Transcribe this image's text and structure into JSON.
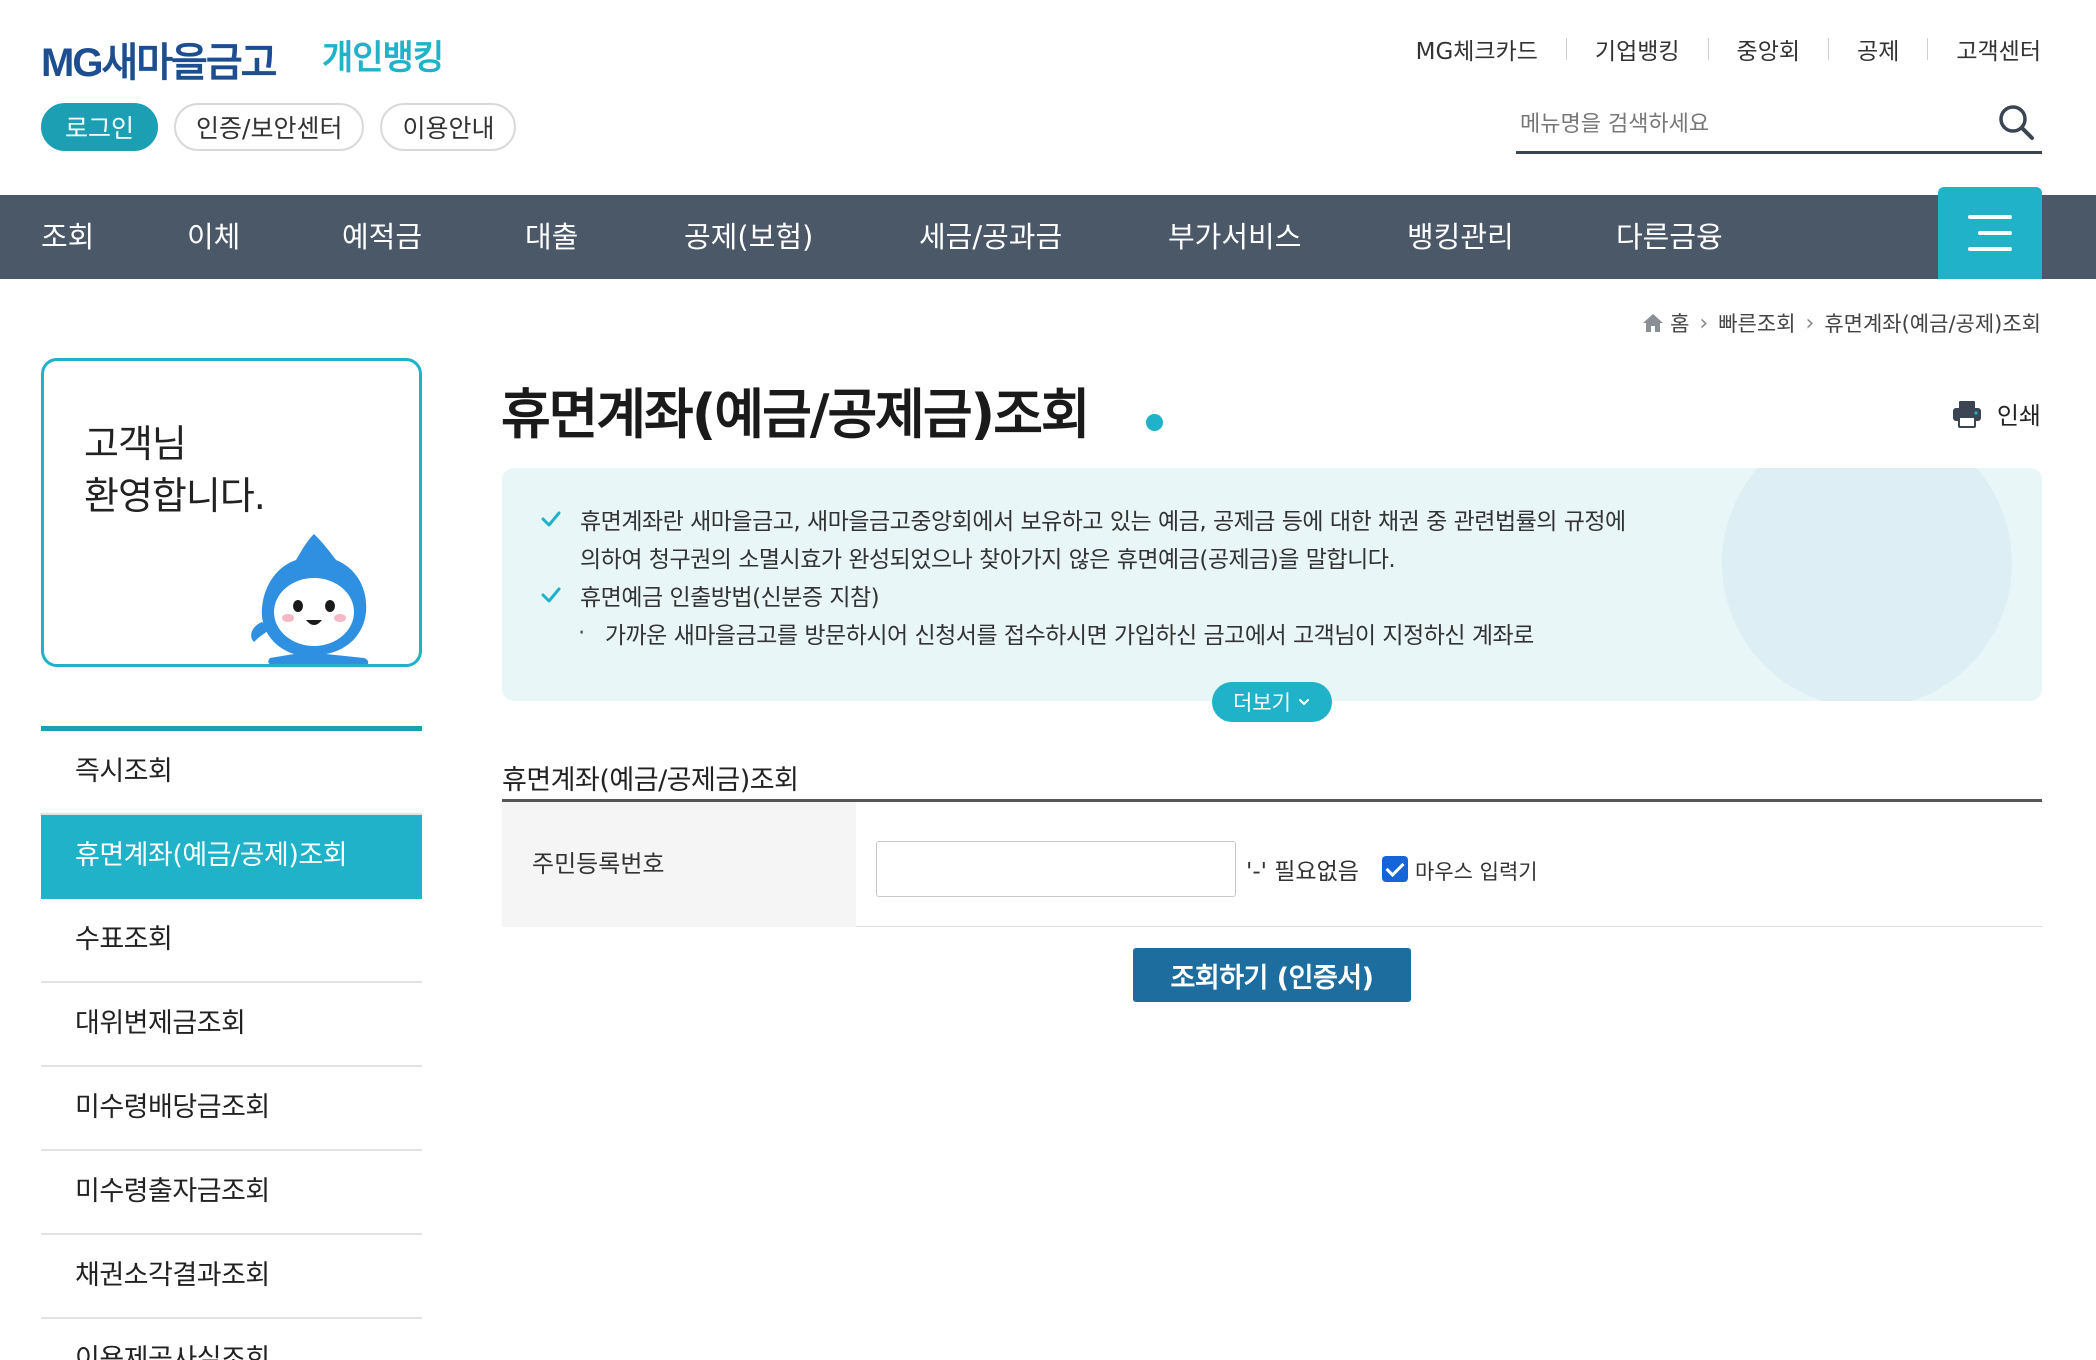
{
  "header": {
    "logo_text": "MG새마을금고",
    "service_name": "개인뱅킹",
    "util_nav": [
      "MG체크카드",
      "기업뱅킹",
      "중앙회",
      "공제",
      "고객센터"
    ],
    "quick_buttons": {
      "login": "로그인",
      "security": "인증/보안센터",
      "guide": "이용안내"
    },
    "search": {
      "placeholder": "메뉴명을 검색하세요",
      "value": ""
    }
  },
  "gnb": {
    "items": [
      "조회",
      "이체",
      "예적금",
      "대출",
      "공제(보험)",
      "세금/공과금",
      "부가서비스",
      "뱅킹관리",
      "다른금융"
    ]
  },
  "breadcrumb": [
    "홈",
    "빠른조회",
    "휴면계좌(예금/공제)조회"
  ],
  "sidebar": {
    "welcome_line1": "고객님",
    "welcome_line2": "환영합니다.",
    "items": [
      {
        "label": "즉시조회",
        "active": false
      },
      {
        "label": "휴면계좌(예금/공제)조회",
        "active": true
      },
      {
        "label": "수표조회",
        "active": false
      },
      {
        "label": "대위변제금조회",
        "active": false
      },
      {
        "label": "미수령배당금조회",
        "active": false
      },
      {
        "label": "미수령출자금조회",
        "active": false
      },
      {
        "label": "채권소각결과조회",
        "active": false
      },
      {
        "label": "이용제공사실조회",
        "active": false
      }
    ]
  },
  "main": {
    "title": "휴면계좌(예금/공제금)조회",
    "print_label": "인쇄",
    "info": {
      "line1": "휴면계좌란 새마을금고, 새마을금고중앙회에서 보유하고 있는 예금, 공제금 등에 대한 채권 중 관련법률의 규정에",
      "line1_cont": "의하여 청구권의 소멸시효가 완성되었으나 찾아가지 않은 휴면예금(공제금)을 말합니다.",
      "line2": "휴면예금 인출방법(신분증 지참)",
      "line2_sub": "가까운 새마을금고를 방문하시어 신청서를 접수하시면 가입하신 금고에서 고객님이 지정하신 계좌로",
      "more_label": "더보기"
    },
    "form": {
      "title": "휴면계좌(예금/공제금)조회",
      "rrn_label": "주민등록번호",
      "rrn_value": "",
      "hint": "'-' 필요없음",
      "mouse_input_label": "마우스 입력기",
      "mouse_input_checked": true
    },
    "submit_label": "조회하기 (인증서)"
  },
  "colors": {
    "brand_blue": "#1d4e8f",
    "accent_teal": "#1fb2c9",
    "gnb_bg": "#4b5868",
    "submit_bg": "#1d6d9e",
    "info_bg": "#e8f6f7"
  },
  "icons": [
    "search-icon",
    "hamburger-icon",
    "home-icon",
    "chevron-right-icon",
    "print-icon",
    "check-icon",
    "chevron-down-icon"
  ]
}
